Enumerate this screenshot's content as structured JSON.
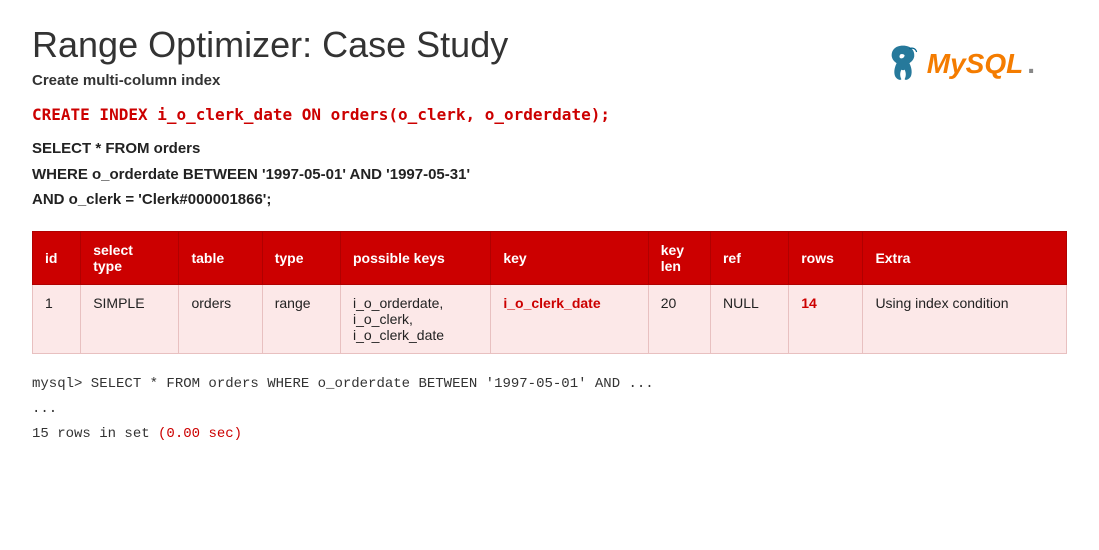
{
  "header": {
    "title": "Range Optimizer:  Case Study",
    "subtitle": "Create multi-column index",
    "logo_text": "MySQL",
    "logo_dot": "."
  },
  "create_index": "CREATE INDEX i_o_clerk_date ON orders(o_clerk, o_orderdate);",
  "select_query": {
    "line1": "SELECT * FROM orders",
    "line2": "WHERE o_orderdate BETWEEN '1997-05-01' AND '1997-05-31'",
    "line3": "AND o_clerk = 'Clerk#000001866';"
  },
  "table": {
    "columns": [
      "id",
      "select type",
      "table",
      "type",
      "possible keys",
      "key",
      "key len",
      "ref",
      "rows",
      "Extra"
    ],
    "rows": [
      {
        "id": "1",
        "select_type": "SIMPLE",
        "table": "orders",
        "type": "range",
        "possible_keys": "i_o_orderdate,\ni_o_clerk,\ni_o_clerk_date",
        "key": "i_o_clerk_date",
        "key_len": "20",
        "ref": "NULL",
        "rows": "14",
        "extra": "Using index condition"
      }
    ]
  },
  "terminal": {
    "line1": "mysql> SELECT * FROM orders WHERE o_orderdate BETWEEN '1997-05-01' AND ...",
    "line2": "...",
    "line3": "15 rows in set (0.00 sec)"
  }
}
